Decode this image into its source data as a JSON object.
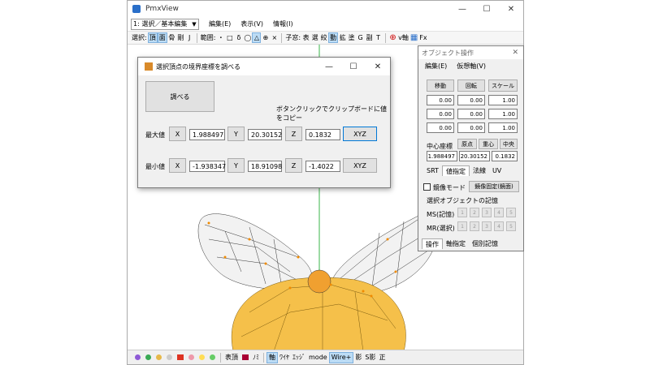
{
  "main_window": {
    "title": "PmxView",
    "window_controls": [
      "—",
      "☐",
      "✕"
    ],
    "mode_select": "1: 選択／基本編集",
    "menu": [
      "編集(E)",
      "表示(V)",
      "情報(I)"
    ],
    "toolbar": {
      "select_label": "選択:",
      "select_items": [
        "頂",
        "面",
        "骨",
        "剛",
        "J"
      ],
      "range_label": "範囲:",
      "range_items": [
        "・",
        "□",
        "δ",
        "◯",
        "△",
        "⊕",
        "×"
      ],
      "child_label": "子窓:",
      "child_items": [
        "表",
        "選",
        "絞",
        "動",
        "拡",
        "塗",
        "G",
        "副",
        "T"
      ],
      "axis_label": "v軸",
      "fx_label": "Fx"
    },
    "statusbar": [
      "表頂",
      "ﾉﾐ",
      "軸",
      "ﾜｲﾔ",
      "ｴｯｼﾞ",
      "mode",
      "Wire+",
      "影",
      "S影",
      "正"
    ]
  },
  "dialog": {
    "title": "選択頂点の境界座標を調べる",
    "check_button": "調べる",
    "hint": "ボタンクリックでクリップボードに値をコピー",
    "rows": [
      {
        "label": "最大値",
        "x": "1.988497",
        "y": "20.30152",
        "z": "0.1832",
        "xyz": "XYZ"
      },
      {
        "label": "最小値",
        "x": "-1.938347",
        "y": "18.91098",
        "z": "-1.4022",
        "xyz": "XYZ"
      }
    ],
    "axis_buttons": [
      "X",
      "Y",
      "Z"
    ]
  },
  "object_panel": {
    "title": "オブジェクト操作",
    "menu": [
      "編集(E)",
      "仮想軸(V)"
    ],
    "buttons": [
      "移動",
      "回転",
      "スケール"
    ],
    "grid": [
      [
        "0.00",
        "0.00",
        "1.00"
      ],
      [
        "0.00",
        "0.00",
        "1.00"
      ],
      [
        "0.00",
        "0.00",
        "1.00"
      ]
    ],
    "center_label": "中心座標",
    "center_buttons": [
      "原点",
      "重心",
      "中央"
    ],
    "center_values": [
      "1.988497",
      "20.30152",
      "0.1832"
    ],
    "tabs": [
      "SRT",
      "値指定",
      "法線",
      "UV"
    ],
    "mirror_checkbox": "鏡像モード",
    "mirror_fix_button": "鏡像固定(鏡面)",
    "memory_group": "選択オブジェクトの記憶",
    "ms_label": "MS(記憶)",
    "mr_label": "MR(選択)",
    "memory_slots": [
      "1",
      "2",
      "3",
      "4",
      "5"
    ],
    "bottom_tabs": [
      "操作",
      "軸指定",
      "個別記憶"
    ]
  }
}
